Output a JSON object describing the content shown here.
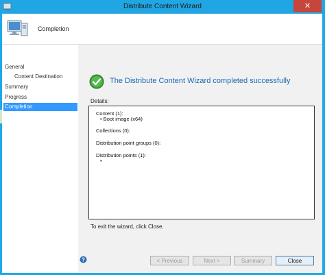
{
  "window": {
    "title": "Distribute Content Wizard",
    "close_glyph": "✕",
    "icons": {
      "window": "wizard-window-icon",
      "close": "close-icon"
    },
    "colors": {
      "titlebar": "#1fa6e3",
      "close_button": "#c7463c"
    }
  },
  "header": {
    "title": "Completion",
    "icon": "computer-icon"
  },
  "nav": {
    "items": [
      {
        "label": "General"
      },
      {
        "label": "Content Destination"
      },
      {
        "label": "Summary"
      },
      {
        "label": "Progress"
      },
      {
        "label": "Completion",
        "active": true
      }
    ],
    "active_color": "#3399ff"
  },
  "main": {
    "success_icon": "green-checkmark-icon",
    "success_title": "The Distribute Content Wizard completed successfully",
    "details_label": "Details:",
    "details": {
      "content_header": "Content (1):",
      "content_item": "• Boot image (x64)",
      "collections": "Collections (0):",
      "dp_groups": "Distribution point groups (0):",
      "dp_header": "Distribution points (1):",
      "dp_item": "•"
    },
    "exit_text": "To exit the wizard, click Close."
  },
  "footer": {
    "help_icon": "help-icon",
    "previous_label": "< Previous",
    "next_label": "Next >",
    "summary_label": "Summary",
    "close_label": "Close"
  }
}
